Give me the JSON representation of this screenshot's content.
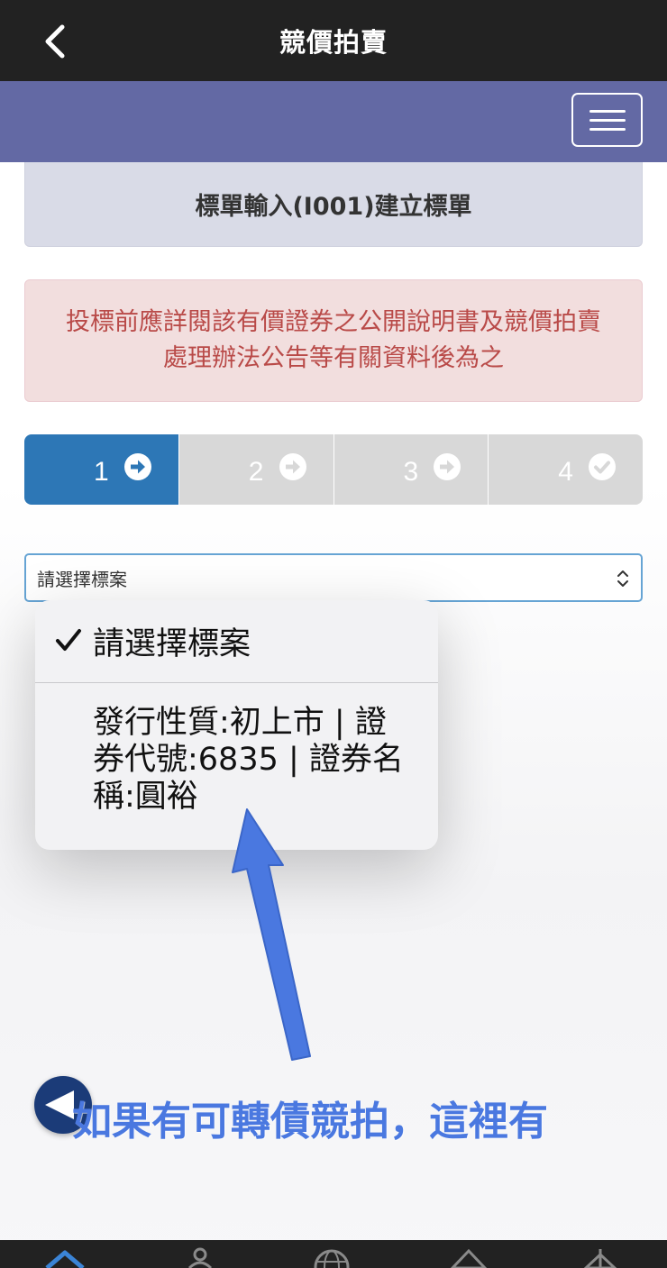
{
  "header": {
    "title": "競價拍賣",
    "back_icon": "chevron-left-icon"
  },
  "navbar": {
    "menu_icon": "hamburger-menu-icon"
  },
  "form_title": "標單輸入(I001)建立標單",
  "warning": {
    "line1": "投標前應詳閱該有價證券之公開說明書及競價拍賣",
    "line2": "處理辦法公告等有關資料後為之"
  },
  "steps": [
    {
      "number": "1",
      "icon": "arrow-right-circle-icon",
      "active": true
    },
    {
      "number": "2",
      "icon": "arrow-right-circle-icon",
      "active": false
    },
    {
      "number": "3",
      "icon": "arrow-right-circle-icon",
      "active": false
    },
    {
      "number": "4",
      "icon": "check-circle-icon",
      "active": false
    }
  ],
  "select": {
    "value": "請選擇標案"
  },
  "dropdown": {
    "options": [
      {
        "label": "請選擇標案",
        "selected": true
      },
      {
        "label_lines": [
          "發行性質:初上市 | 證",
          "券代號:6835 | 證券名",
          "稱:圓裕"
        ],
        "selected": false
      }
    ]
  },
  "annotation": {
    "text": "如果有可轉債競拍，這裡有",
    "color": "#4a78e0"
  },
  "colors": {
    "header_bg": "#222222",
    "navbar_bg": "#6369a4",
    "step_active": "#2d77b6",
    "step_inactive": "#d8d8d8",
    "warning_text": "#b94a48"
  },
  "tab_bar": {
    "icons": [
      "home-icon",
      "users-icon",
      "globe-icon",
      "tag-icon",
      "bank-icon"
    ]
  }
}
